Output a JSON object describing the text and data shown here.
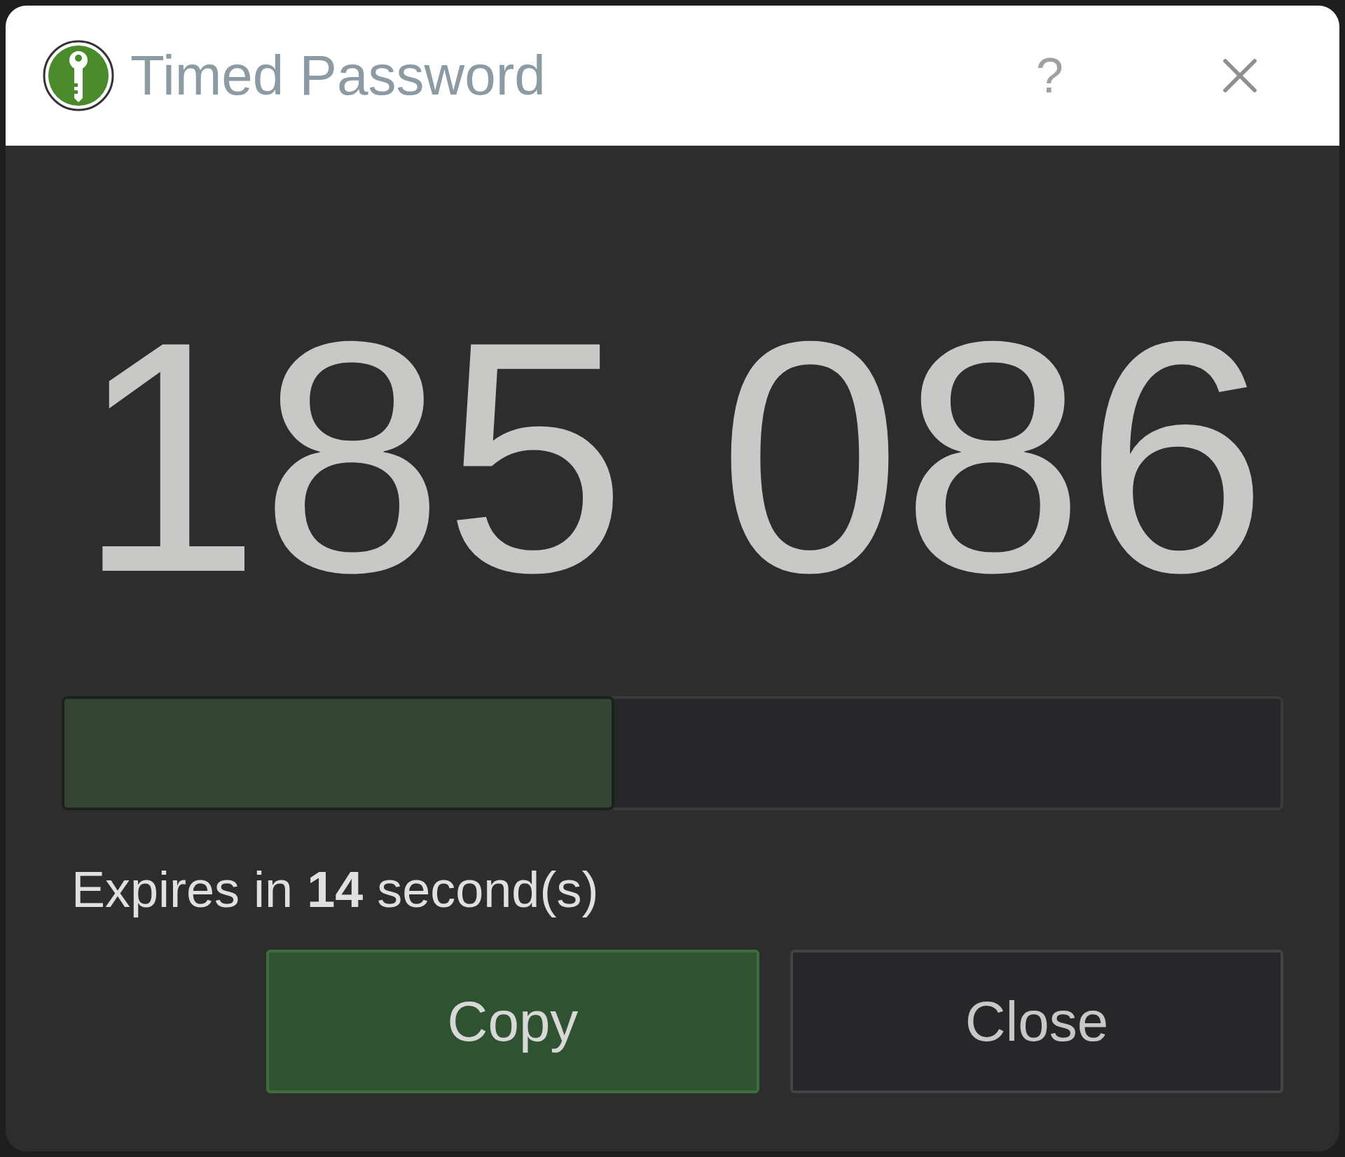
{
  "window": {
    "title": "Timed Password",
    "help": "?"
  },
  "code": "185 086",
  "progress": {
    "level": 0.45
  },
  "expiry": "Expires in **14** second(s)",
  "buttons": [
    {
      "label": "Copy",
      "kind": "primary"
    },
    {
      "label": "Close",
      "kind": "secondary"
    }
  ]
}
